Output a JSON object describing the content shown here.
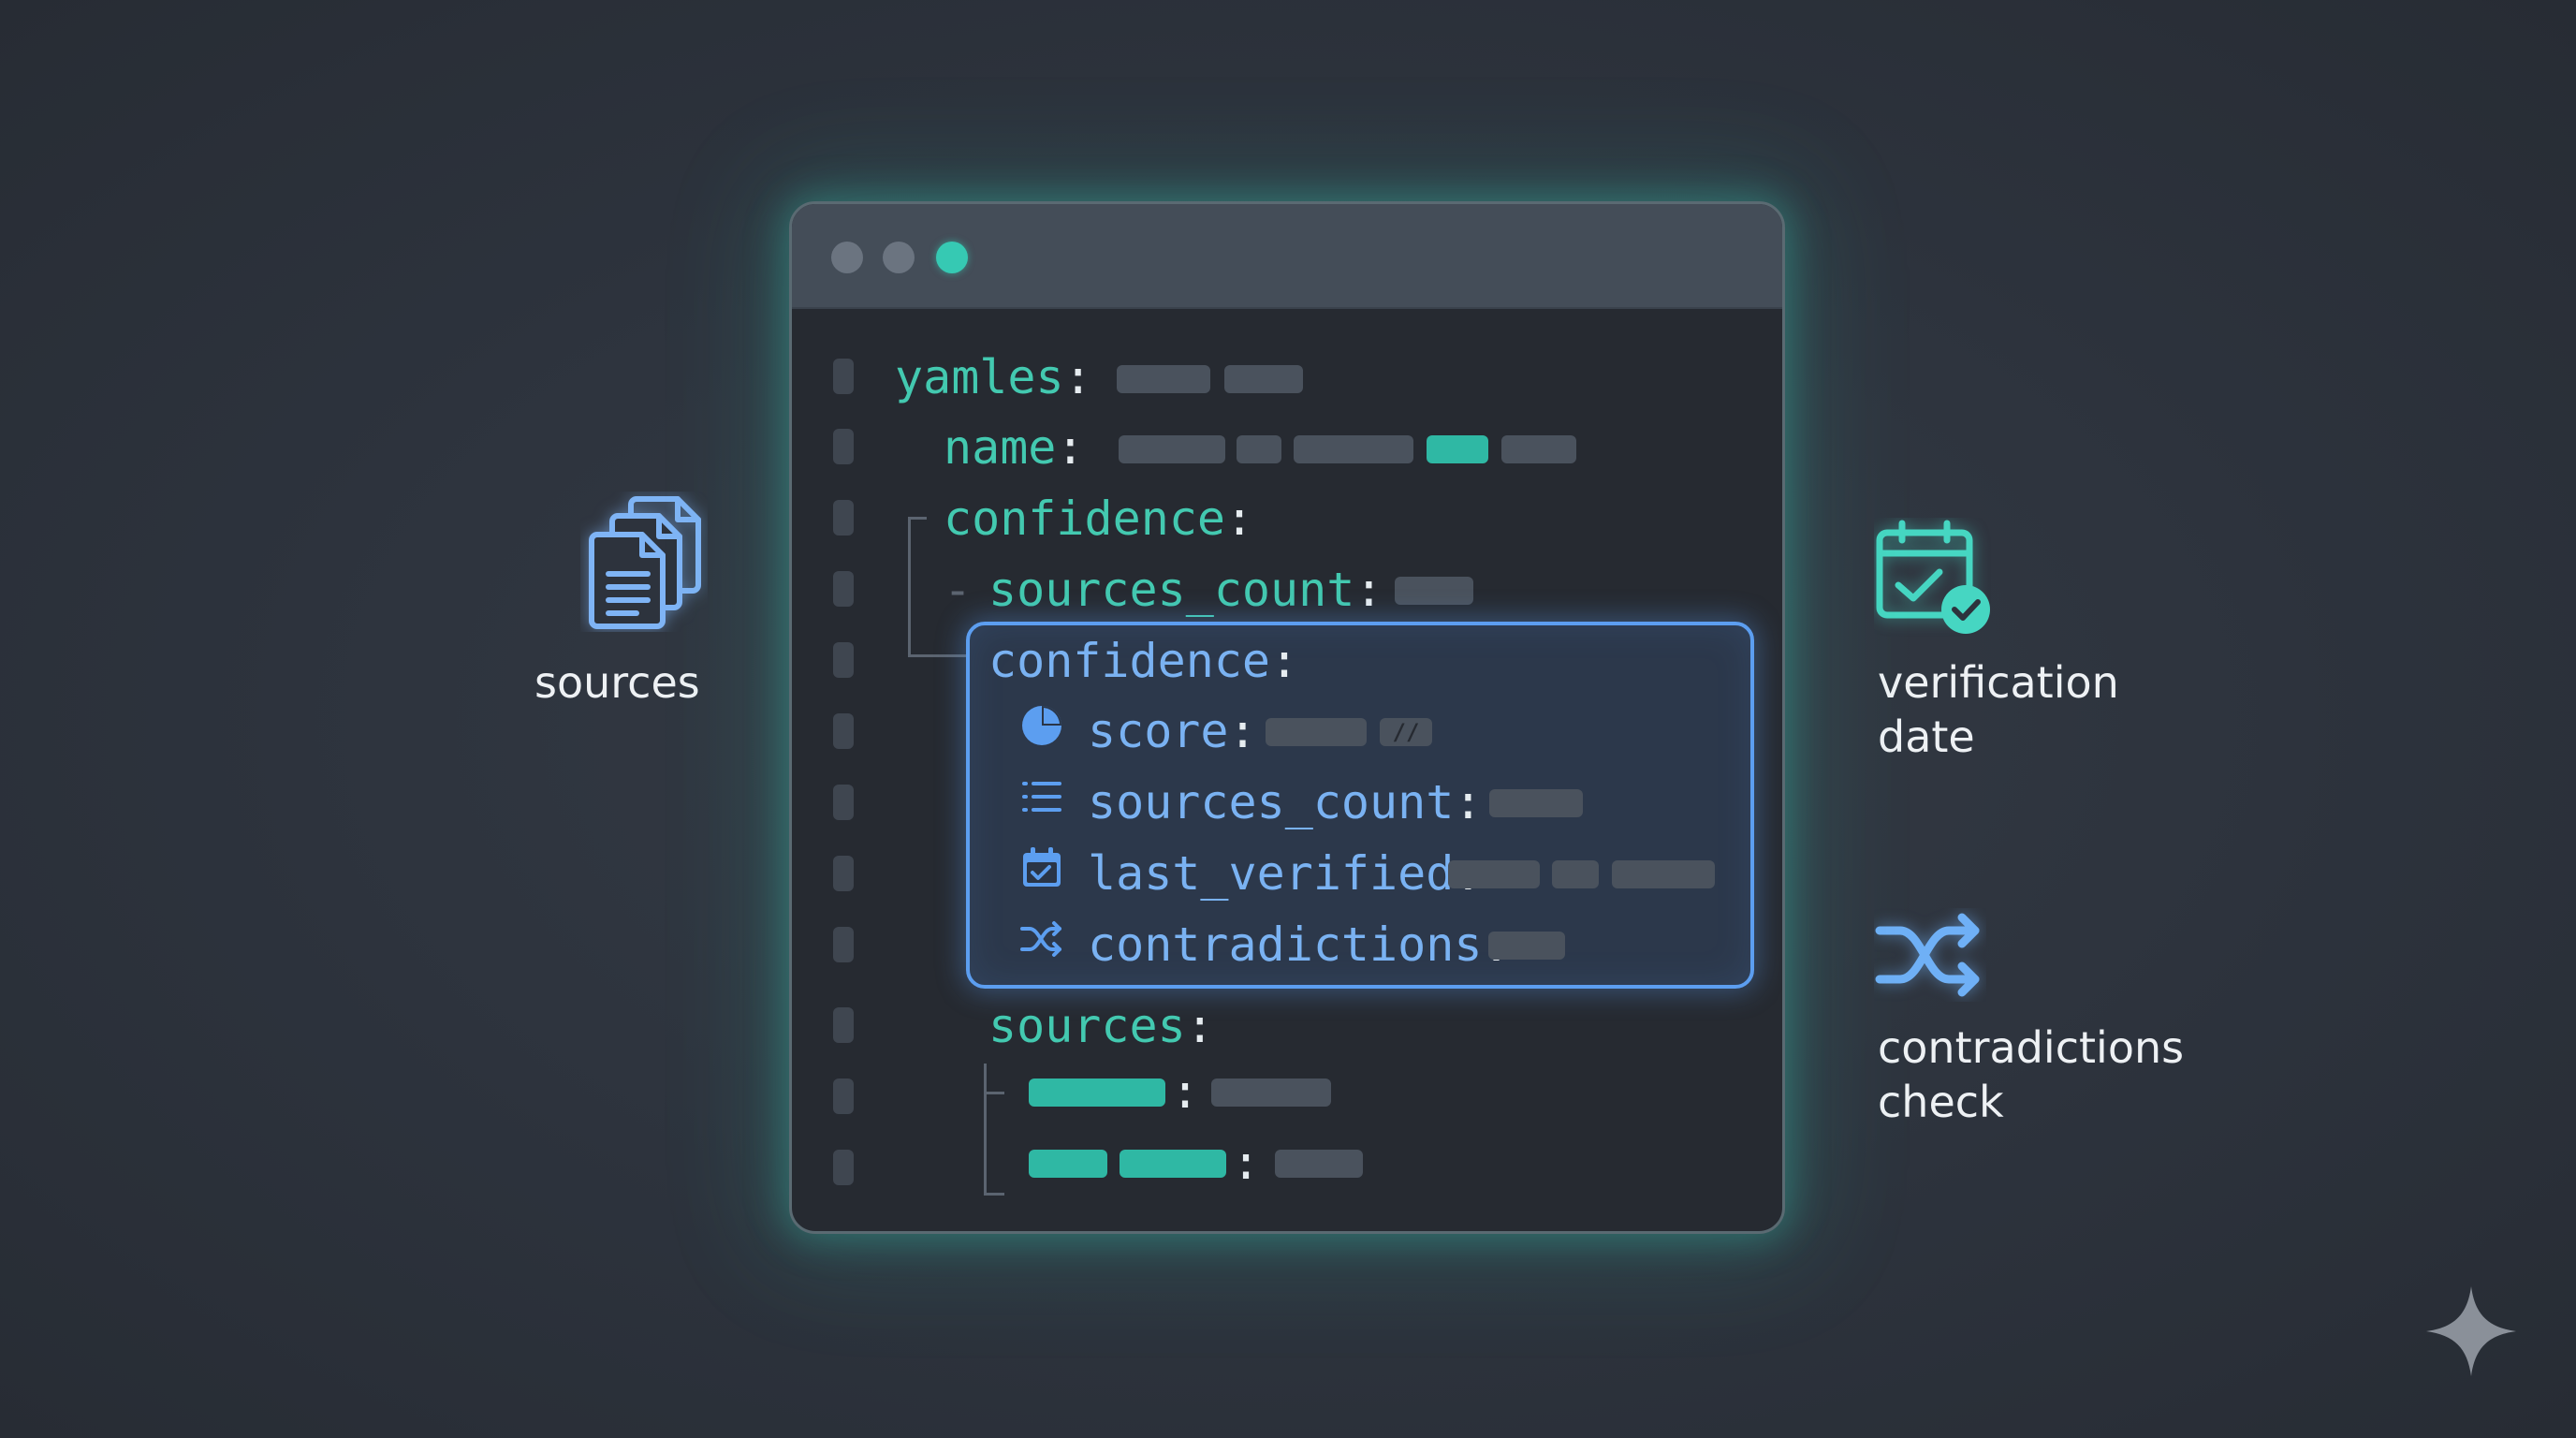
{
  "code": {
    "line_yamles_key": "yamles",
    "line_name_key": "name",
    "line_confidence_key": "confidence",
    "line_sources_count_key": "sources_count",
    "highlight": {
      "confidence_key": "confidence",
      "score_key": "score",
      "sources_count_key": "sources_count",
      "last_verified_key": "last_verified",
      "contradictions_key": "contradictions"
    },
    "line_sources_key": "sources",
    "colon": ":",
    "dash": "-",
    "score_glyph": "//"
  },
  "annotations": {
    "sources": {
      "label": "sources",
      "icon": "documents-stack-icon",
      "color": "#7fb4f5"
    },
    "verification": {
      "label_line1": "verification",
      "label_line2": "date",
      "icon": "calendar-check-icon",
      "color": "#46d6c2"
    },
    "contradictions": {
      "label_line1": "contradictions",
      "label_line2": "check",
      "icon": "shuffle-arrows-icon",
      "color": "#6fb0f6"
    }
  },
  "colors": {
    "background": "#2d333d",
    "window_glow": "#38c8b4",
    "teal_key": "#43c9b0",
    "blue_key": "#7ab2f2",
    "highlight_border": "#5c9ef0"
  }
}
